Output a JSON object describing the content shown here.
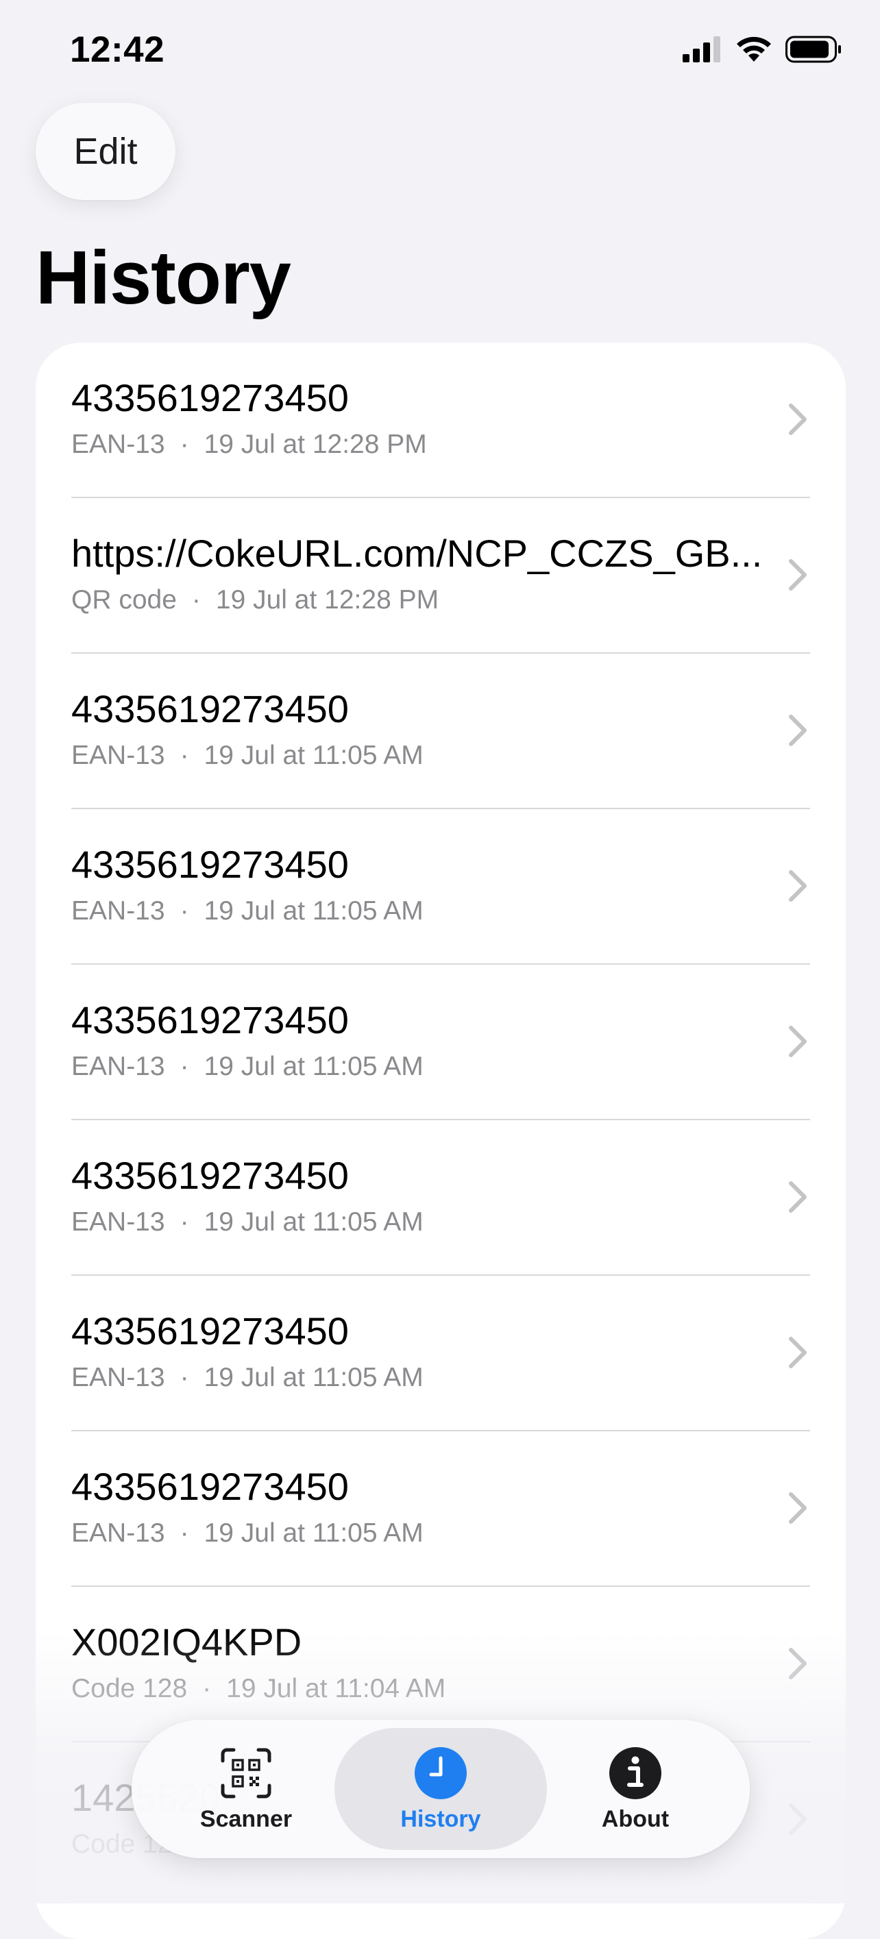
{
  "status_bar": {
    "time": "12:42"
  },
  "header": {
    "edit_label": "Edit",
    "title": "History"
  },
  "history": {
    "items": [
      {
        "value": "4335619273450",
        "type": "EAN-13",
        "separator": "·",
        "timestamp": "19 Jul at 12:28 PM"
      },
      {
        "value": "https://CokeURL.com/NCP_CCZS_GB...",
        "type": "QR code",
        "separator": "·",
        "timestamp": "19 Jul at 12:28 PM"
      },
      {
        "value": "4335619273450",
        "type": "EAN-13",
        "separator": "·",
        "timestamp": "19 Jul at 11:05 AM"
      },
      {
        "value": "4335619273450",
        "type": "EAN-13",
        "separator": "·",
        "timestamp": "19 Jul at 11:05 AM"
      },
      {
        "value": "4335619273450",
        "type": "EAN-13",
        "separator": "·",
        "timestamp": "19 Jul at 11:05 AM"
      },
      {
        "value": "4335619273450",
        "type": "EAN-13",
        "separator": "·",
        "timestamp": "19 Jul at 11:05 AM"
      },
      {
        "value": "4335619273450",
        "type": "EAN-13",
        "separator": "·",
        "timestamp": "19 Jul at 11:05 AM"
      },
      {
        "value": "4335619273450",
        "type": "EAN-13",
        "separator": "·",
        "timestamp": "19 Jul at 11:05 AM"
      },
      {
        "value": "X002IQ4KPD",
        "type": "Code 128",
        "separator": "·",
        "timestamp": "19 Jul at 11:04 AM"
      },
      {
        "value": "1425520",
        "type": "Code 128",
        "separator": "",
        "timestamp": ""
      }
    ]
  },
  "tab_bar": {
    "tabs": [
      {
        "label": "Scanner",
        "icon": "qr-scanner-icon",
        "active": false
      },
      {
        "label": "History",
        "icon": "clock-icon",
        "active": true
      },
      {
        "label": "About",
        "icon": "info-icon",
        "active": false
      }
    ]
  },
  "colors": {
    "accent": "#1f7ff0",
    "background": "#f2f2f7",
    "secondary_text": "#8a8a8e"
  }
}
